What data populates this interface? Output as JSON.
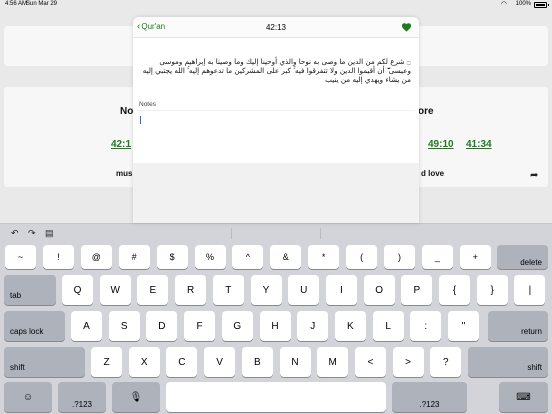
{
  "status_bar": {
    "time": "4:56 AM",
    "date": "Sun Mar 29",
    "battery_pct": "100%",
    "wifi_icon": "wifi-icon",
    "battery_icon": "battery-icon"
  },
  "background": {
    "left_word": "No",
    "right_word": "ore",
    "left_time": "42:1",
    "right_times": [
      "49:10",
      "41:34"
    ],
    "left_caption": "musi",
    "right_caption": "d love"
  },
  "modal": {
    "back_label": "Qur'an",
    "title": "42:13",
    "verse": "۝ شرع لكم من الدين ما وصى به نوحا والذي أوحينا إليك وما وصينا به إبراهيم وموسى وعيسى ۖ أن أقيموا الدين ولا تتفرقوا فيه ۚ كبر على المشركين ما تدعوهم إليه ۚ الله يجتبي إليه من يشاء ويهدي إليه من ينيب",
    "notes_label": "Notes",
    "notes_value": "",
    "accent_color": "#1e7a1e"
  },
  "keyboard": {
    "toolbar_icons": [
      "undo-icon",
      "redo-icon",
      "paste-icon"
    ],
    "row1": [
      "~",
      "!",
      "@",
      "#",
      "$",
      "%",
      "^",
      "&",
      "*",
      "(",
      ")",
      "_",
      "+"
    ],
    "delete_label": "delete",
    "tab_label": "tab",
    "row2": [
      "Q",
      "W",
      "E",
      "R",
      "T",
      "Y",
      "U",
      "I",
      "O",
      "P",
      "{",
      "}",
      "|"
    ],
    "caps_label": "caps lock",
    "row3": [
      "A",
      "S",
      "D",
      "F",
      "G",
      "H",
      "J",
      "K",
      "L",
      ":",
      "\""
    ],
    "return_label": "return",
    "shift_label": "shift",
    "row4": [
      "Z",
      "X",
      "C",
      "V",
      "B",
      "N",
      "M",
      "<",
      ">",
      "?"
    ],
    "numbers_label": ".?123",
    "emoji_icon": "emoji-icon",
    "mic_icon": "microphone-icon",
    "dismiss_icon": "keyboard-dismiss-icon"
  }
}
